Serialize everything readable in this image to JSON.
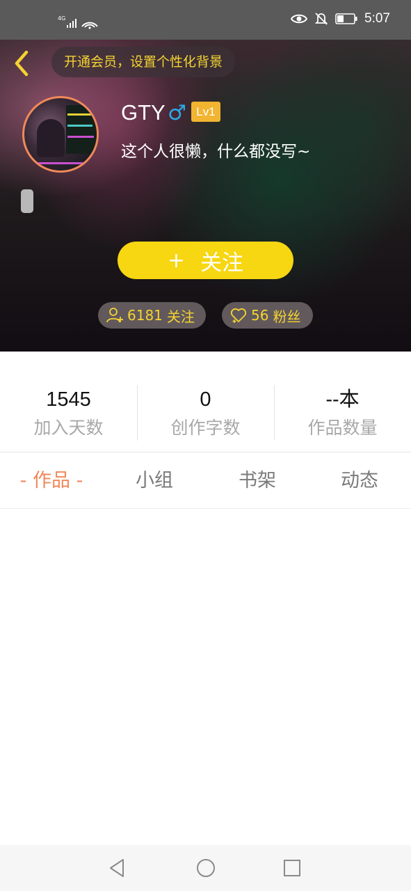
{
  "status_bar": {
    "network_type": "4G",
    "time": "5:07"
  },
  "header": {
    "vip_banner": "开通会员，设置个性化背景",
    "username": "GTY",
    "gender_symbol": "♂",
    "level": "Lv1",
    "bio": "这个人很懒，什么都没写~",
    "follow_button": {
      "icon": "+",
      "label": "关注"
    },
    "following": {
      "count": "6181",
      "label": "关注"
    },
    "fans": {
      "count": "56",
      "label": "粉丝"
    }
  },
  "stats": [
    {
      "value": "1545",
      "label": "加入天数"
    },
    {
      "value": "0",
      "label": "创作字数"
    },
    {
      "value": "--本",
      "label": "作品数量"
    }
  ],
  "tabs": [
    {
      "label": "- 作品 -",
      "active": true
    },
    {
      "label": "小组",
      "active": false
    },
    {
      "label": "书架",
      "active": false
    },
    {
      "label": "动态",
      "active": false
    }
  ],
  "colors": {
    "accent": "#f0875a",
    "follow_button": "#f7d612",
    "highlight_text": "#f5d332",
    "gender": "#2ea8e8",
    "level_badge": "#f2b531"
  }
}
